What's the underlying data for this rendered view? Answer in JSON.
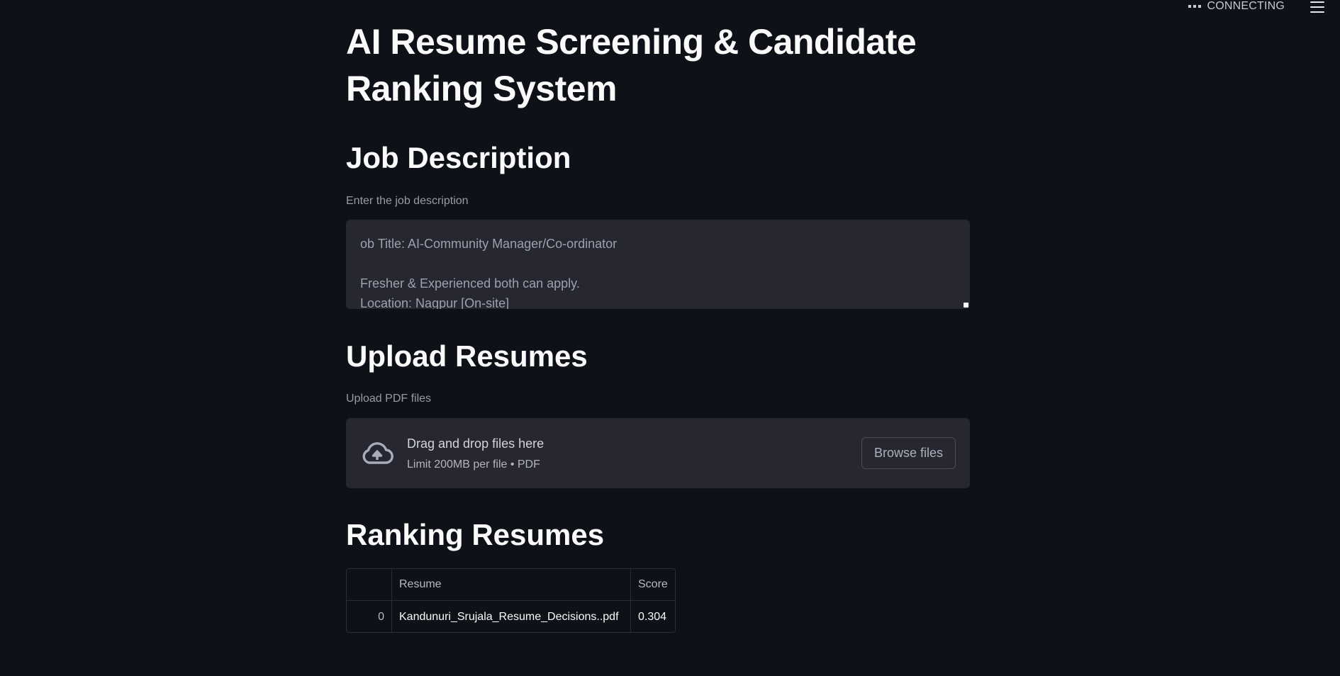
{
  "status": {
    "label": "CONNECTING"
  },
  "title": "AI Resume Screening & Candidate Ranking System",
  "job_section": {
    "heading": "Job Description",
    "input_label": "Enter the job description",
    "text_value": "ob Title: AI-Community Manager/Co-ordinator\n\nFresher & Experienced both can apply.\nLocation: Nagpur [On-site]"
  },
  "upload_section": {
    "heading": "Upload Resumes",
    "input_label": "Upload PDF files",
    "drop_text": "Drag and drop files here",
    "limit_text": "Limit 200MB per file • PDF",
    "browse_label": "Browse files"
  },
  "ranking_section": {
    "heading": "Ranking Resumes",
    "columns": [
      "",
      "Resume",
      "Score"
    ],
    "rows": [
      {
        "index": "0",
        "resume": "Kandunuri_Srujala_Resume_Decisions..pdf",
        "score": "0.304"
      }
    ]
  },
  "icons": {
    "status": "dots-icon",
    "menu": "hamburger-menu-icon",
    "upload": "cloud-upload-icon"
  }
}
